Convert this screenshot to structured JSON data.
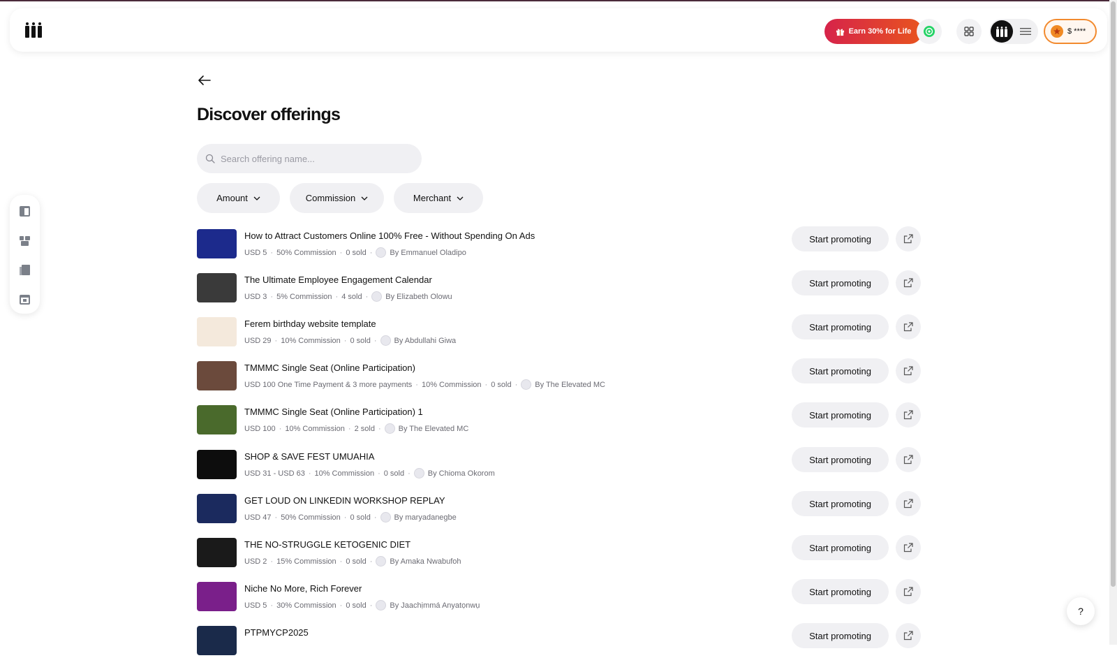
{
  "header": {
    "earn_label": "Earn 30% for Life",
    "balance_label": "$ ****"
  },
  "page": {
    "title": "Discover offerings",
    "search_placeholder": "Search offering name..."
  },
  "filters": [
    {
      "label": "Amount"
    },
    {
      "label": "Commission"
    },
    {
      "label": "Merchant"
    }
  ],
  "offerings": [
    {
      "name": "How to Attract Customers Online 100% Free - Without Spending On Ads",
      "price": "USD 5",
      "commission": "50% Commission",
      "sold": "0 sold",
      "merchant": "By Emmanuel Oladipo",
      "thumb_color": "#1c2a8c"
    },
    {
      "name": "The Ultimate Employee Engagement Calendar",
      "price": "USD 3",
      "commission": "5% Commission",
      "sold": "4 sold",
      "merchant": "By Elizabeth Olowu",
      "thumb_color": "#3a3a3a"
    },
    {
      "name": "Ferem birthday website template",
      "price": "USD 29",
      "commission": "10% Commission",
      "sold": "0 sold",
      "merchant": "By Abdullahi Giwa",
      "thumb_color": "#f4e9dc"
    },
    {
      "name": "TMMMC Single Seat (Online Participation)",
      "price": "USD 100 One Time Payment & 3 more payments",
      "commission": "10% Commission",
      "sold": "0 sold",
      "merchant": "By The Elevated MC",
      "thumb_color": "#6b4a3c"
    },
    {
      "name": "TMMMC Single Seat (Online Participation) 1",
      "price": "USD 100",
      "commission": "10% Commission",
      "sold": "2 sold",
      "merchant": "By The Elevated MC",
      "thumb_color": "#4a6a2c"
    },
    {
      "name": "SHOP & SAVE FEST UMUAHIA",
      "price": "USD 31 - USD 63",
      "commission": "10% Commission",
      "sold": "0 sold",
      "merchant": "By Chioma Okorom",
      "thumb_color": "#0d0d0d"
    },
    {
      "name": "GET LOUD ON LINKEDIN WORKSHOP REPLAY",
      "price": "USD 47",
      "commission": "50% Commission",
      "sold": "0 sold",
      "merchant": "By maryadanegbe",
      "thumb_color": "#1b2a5e"
    },
    {
      "name": "THE NO-STRUGGLE KETOGENIC DIET",
      "price": "USD 2",
      "commission": "15% Commission",
      "sold": "0 sold",
      "merchant": "By Amaka Nwabufoh",
      "thumb_color": "#1a1a1a"
    },
    {
      "name": "Niche No More, Rich Forever",
      "price": "USD 5",
      "commission": "30% Commission",
      "sold": "0 sold",
      "merchant": "By Jaachịmmá Anyatọnwụ",
      "thumb_color": "#7a1f8a"
    },
    {
      "name": "PTPMYCP2025",
      "price": "",
      "commission": "",
      "sold": "",
      "merchant": "",
      "thumb_color": "#1a2a4a"
    }
  ],
  "actions": {
    "promote_label": "Start promoting"
  },
  "help_label": "?"
}
